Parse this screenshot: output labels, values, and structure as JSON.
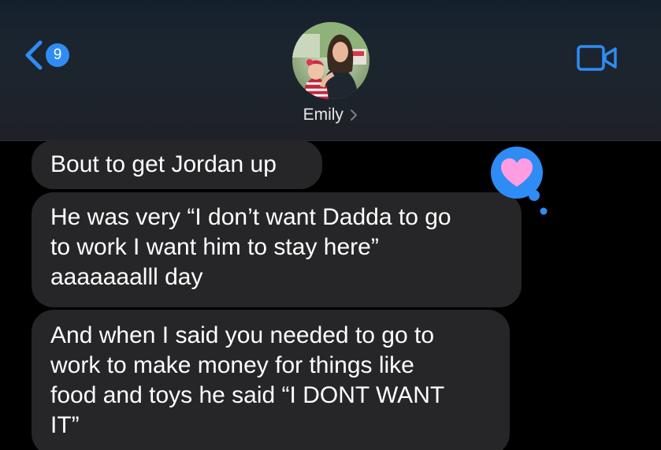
{
  "header": {
    "unread_count": "9",
    "contact_name": "Emily",
    "back_icon": "chevron-left-icon",
    "video_icon": "video-camera-icon",
    "accent_color": "#2f8cf4"
  },
  "messages": [
    {
      "text": "Bout to get Jordan up"
    },
    {
      "text": "He was very “I don’t want Dadda to go\nto work I want him to stay here”\naaaaaaalll day",
      "reaction": "heart-icon"
    },
    {
      "text": "And when I said you needed to go to\nwork to make money for things like\nfood and toys he said “I DONT WANT\nIT”"
    }
  ],
  "colors": {
    "bubble": "#262628",
    "background": "#000000",
    "tapback": "#2f8cf4",
    "heart": "#ff8fe0"
  }
}
